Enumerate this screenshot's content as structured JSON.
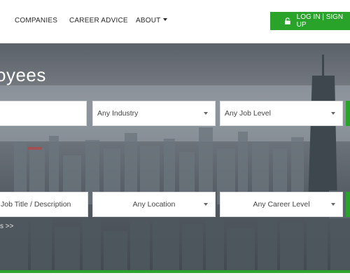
{
  "nav": {
    "companies": "COMPANIES",
    "career_advice": "CAREER ADVICE",
    "about": "ABOUT",
    "login": "LOG IN | SIGN UP"
  },
  "hero": {
    "title": "oyees"
  },
  "search_row1": {
    "keyword": "",
    "industry": "Any Industry",
    "job_level": "Any Job Level"
  },
  "search_row2": {
    "title_desc": "Job Title / Description",
    "location": "Any Location",
    "career_level": "Any Career Level",
    "more_link": "s >>"
  },
  "colors": {
    "accent": "#2aa32a"
  }
}
